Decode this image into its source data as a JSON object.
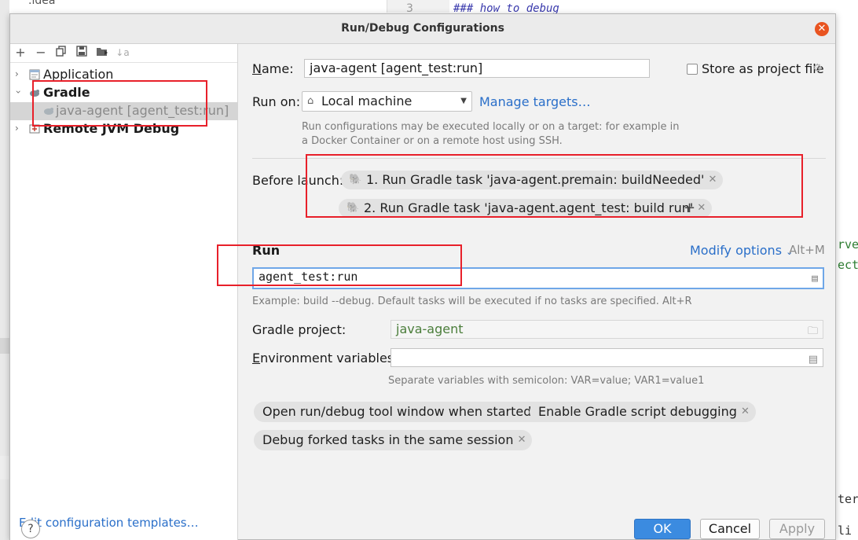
{
  "background": {
    "project_item": ".idea",
    "editor_line_number": "3",
    "editor_code": "### how to debug",
    "right_fragments": [
      "rve",
      "ect",
      "ter",
      "li"
    ],
    "left_fragment": "u"
  },
  "dialog": {
    "title": "Run/Debug Configurations",
    "close_icon": "close-icon"
  },
  "toolbar": {
    "icons": [
      "add-icon",
      "remove-icon",
      "copy-icon",
      "save-icon",
      "move-to-folder-icon",
      "sort-icon"
    ],
    "add": "+",
    "remove": "−",
    "sort": "↓a"
  },
  "tree": {
    "items": [
      {
        "label": "Application",
        "icon": "application-icon",
        "expanded": false
      },
      {
        "label": "Gradle",
        "icon": "gradle-icon",
        "expanded": true
      },
      {
        "label": "java-agent [agent_test:run]",
        "icon": "gradle-task-icon",
        "selected": true
      },
      {
        "label": "Remote JVM Debug",
        "icon": "remote-debug-icon",
        "expanded": false
      }
    ]
  },
  "edit_templates_link": "Edit configuration templates…",
  "help_label": "?",
  "form": {
    "name_label": "Name:",
    "name_value": "java-agent [agent_test:run]",
    "store_label": "Store as project file",
    "store_checked": false,
    "run_on_label": "Run on:",
    "run_on_value": "Local machine",
    "manage_targets": "Manage targets…",
    "run_on_hint_1": "Run configurations may be executed locally or on a target: for example in",
    "run_on_hint_2": "a Docker Container or on a remote host using SSH.",
    "before_launch_label": "Before launch:",
    "before_launch_tasks": [
      "1. Run Gradle task 'java-agent.premain: buildNeeded'",
      "2. Run Gradle task 'java-agent.agent_test: build run'"
    ],
    "add_task": "+",
    "run_section": "Run",
    "modify_options": "Modify options",
    "modify_shortcut": "Alt+M",
    "run_value": "agent_test:run",
    "run_hint": "Example: build --debug. Default tasks will be executed if no tasks are specified. Alt+R",
    "gradle_project_label": "Gradle project:",
    "gradle_project_value": "java-agent",
    "env_label": "Environment variables:",
    "env_value": "",
    "env_hint": "Separate variables with semicolon: VAR=value; VAR1=value1",
    "options": [
      "Open run/debug tool window when started",
      "Enable Gradle script debugging",
      "Debug forked tasks in the same session"
    ]
  },
  "buttons": {
    "ok": "OK",
    "cancel": "Cancel",
    "apply": "Apply"
  },
  "colors": {
    "accent": "#3b8be0",
    "link": "#2a6fc9",
    "annotation": "#e8202a",
    "close": "#e95420"
  }
}
